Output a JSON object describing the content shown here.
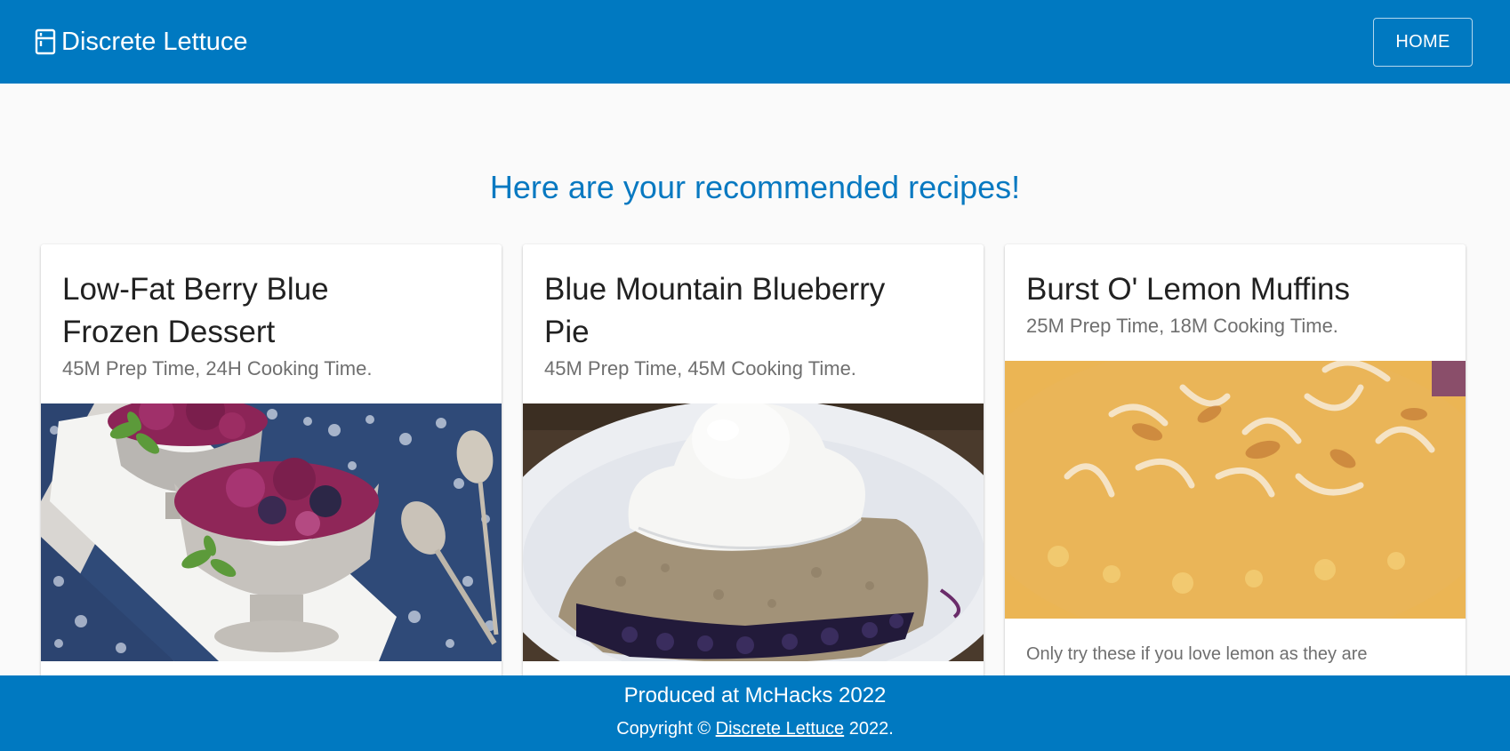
{
  "header": {
    "brand_icon": "kitchen-icon",
    "title": "Discrete Lettuce",
    "home_label": "HOME"
  },
  "main": {
    "heading": "Here are your recommended recipes!"
  },
  "recipes": [
    {
      "title_line1": "Low-Fat Berry Blue",
      "title_line2": "Frozen Dessert",
      "times": "45M Prep Time, 24H Cooking Time.",
      "image": "berry-frozen-dessert-photo",
      "description": ""
    },
    {
      "title_line1": "Blue Mountain Blueberry",
      "title_line2": "Pie",
      "times": "45M Prep Time, 45M Cooking Time.",
      "image": "blueberry-pie-photo",
      "description": ""
    },
    {
      "title_line1": "Burst O' Lemon Muffins",
      "title_line2": "",
      "times": "25M Prep Time, 18M Cooking Time.",
      "image": "lemon-muffin-photo",
      "description": "Only try these if you love lemon as they are"
    }
  ],
  "footer": {
    "line1": "Produced at McHacks 2022",
    "copyright_prefix": "Copyright ©",
    "copyright_link": "Discrete Lettuce",
    "copyright_suffix": "2022."
  },
  "colors": {
    "primary": "#0079c1",
    "heading": "#0879c1",
    "background": "#fafafa"
  }
}
